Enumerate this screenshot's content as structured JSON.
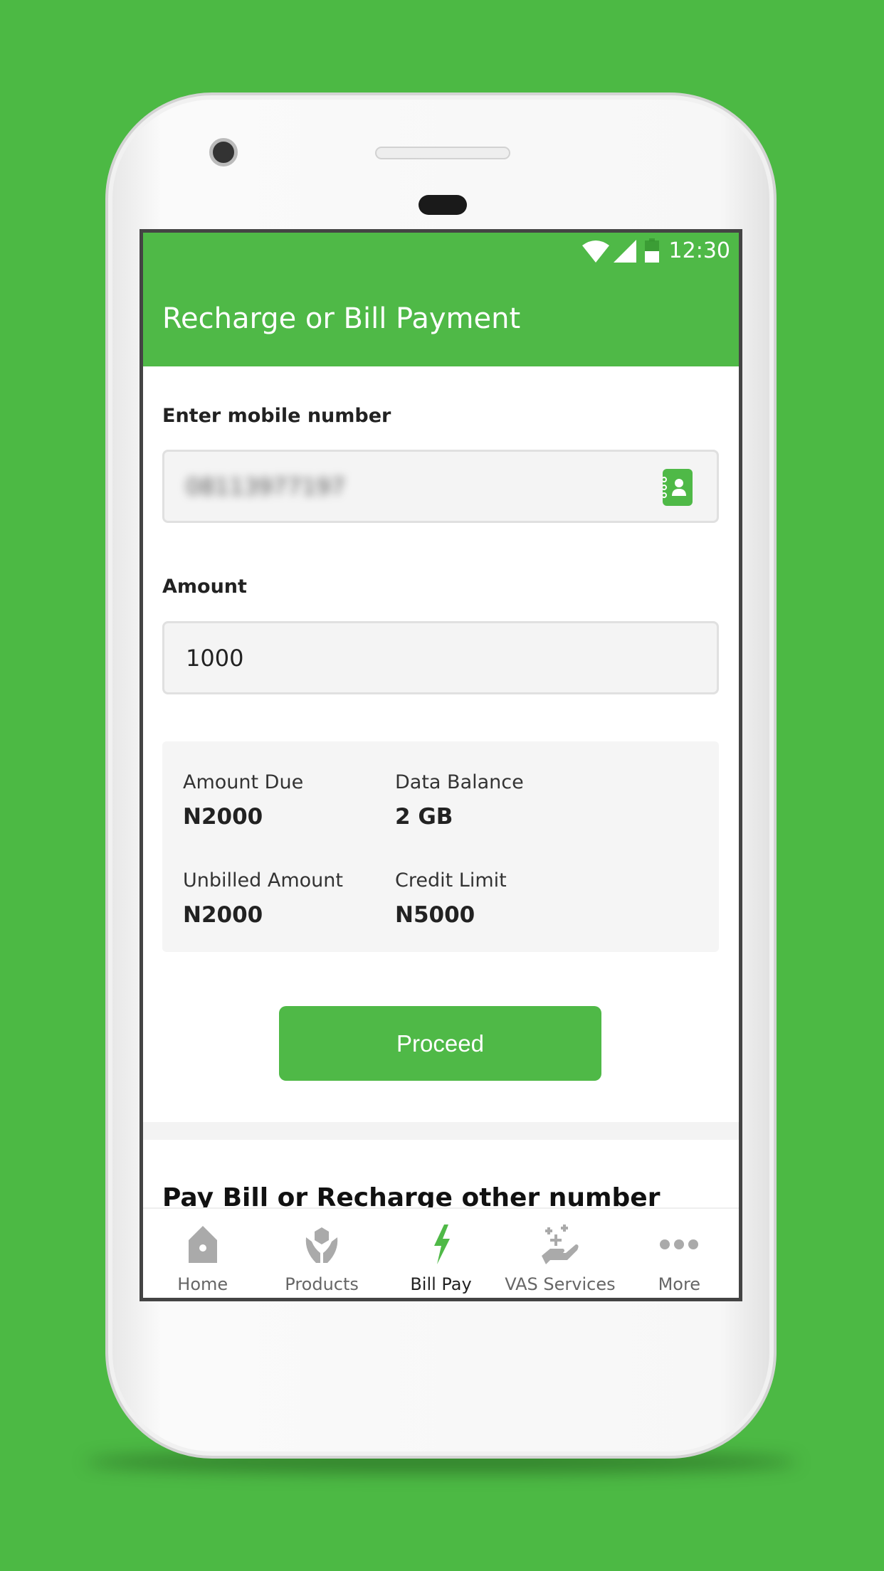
{
  "status_bar": {
    "time": "12:30",
    "icons": [
      "wifi-icon",
      "signal-icon",
      "battery-icon"
    ]
  },
  "header": {
    "title": "Recharge or Bill Payment"
  },
  "form": {
    "mobile_label": "Enter mobile number",
    "mobile_value": "08113977197",
    "amount_label": "Amount",
    "amount_value": "1000"
  },
  "info": {
    "amount_due_label": "Amount Due",
    "amount_due": "N2000",
    "data_balance_label": "Data Balance",
    "data_balance": "2 GB",
    "unbilled_label": "Unbilled Amount",
    "unbilled": "N2000",
    "credit_limit_label": "Credit Limit",
    "credit_limit": "N5000"
  },
  "proceed_label": "Proceed",
  "other_section_title": "Pay Bill or Recharge other number",
  "nav": [
    {
      "label": "Home",
      "icon": "home-icon"
    },
    {
      "label": "Products",
      "icon": "products-icon"
    },
    {
      "label": "Bill Pay",
      "icon": "lightning-icon",
      "active": true
    },
    {
      "label": "VAS Services",
      "icon": "vas-hand-icon"
    },
    {
      "label": "More",
      "icon": "more-dots-icon"
    }
  ],
  "colors": {
    "brand": "#4fb947",
    "background": "#4cb944",
    "inactive": "#aaaaaa"
  }
}
